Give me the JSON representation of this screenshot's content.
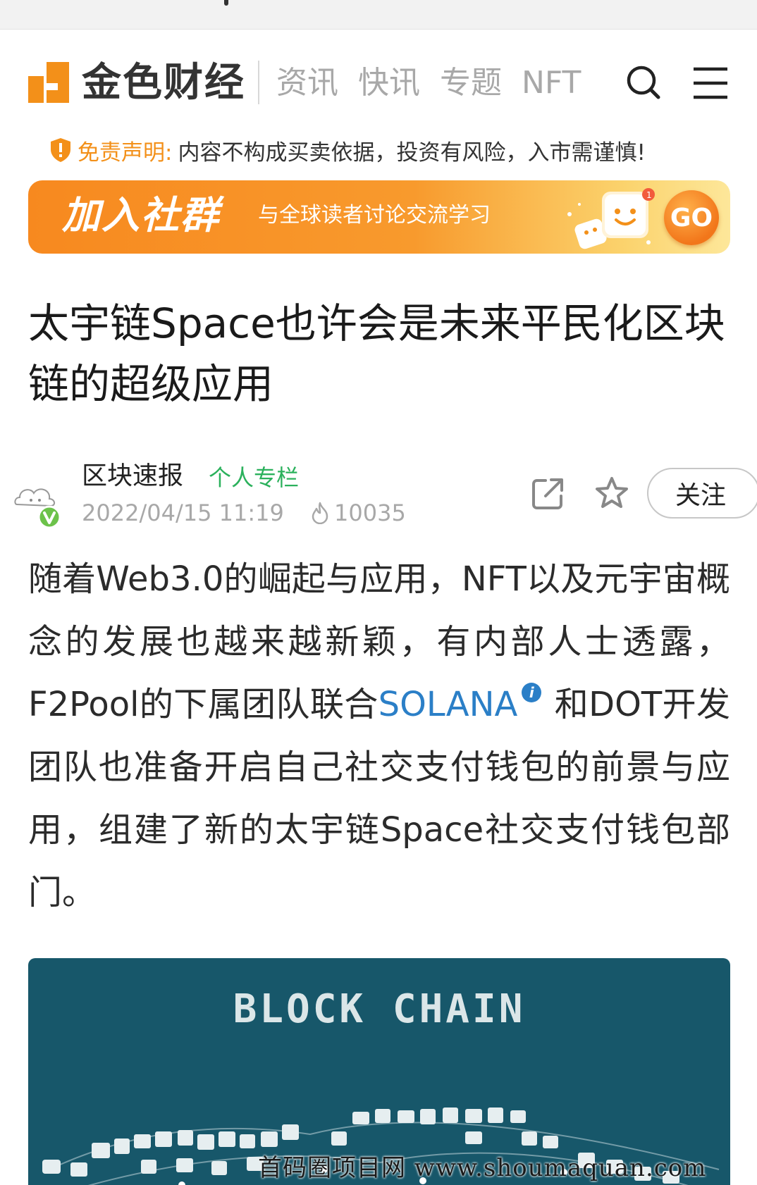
{
  "header": {
    "brand": "金色财经",
    "nav": [
      "资讯",
      "快讯",
      "专题",
      "NFT"
    ],
    "accent_color": "#f39019",
    "icons": [
      "search-icon",
      "menu-icon"
    ]
  },
  "disclaimer": {
    "label": "免责声明:",
    "text": "内容不构成买卖依据，投资有风险，入市需谨慎!"
  },
  "banner": {
    "title": "加入社群",
    "subtitle": "与全球读者讨论交流学习",
    "go_label": "GO"
  },
  "article": {
    "title": "太宇链Space也许会是未来平民化区块链的超级应用",
    "author": {
      "name": "区块速报",
      "tag": "个人专栏",
      "date": "2022/04/15 11:19",
      "views": "10035",
      "follow_label": "关注"
    },
    "body_before_link": "随着Web3.0的崛起与应用，NFT以及元宇宙概念的发展也越来越新颖，有内部人士透露，F2Pool的下属团队联合",
    "body_link": "SOLANA",
    "body_after_link": "和DOT开发团队也准备开启自己社交支付钱包的前景与应用，组建了新的太宇链Space社交支付钱包部门。",
    "image_caption": "BLOCK CHAIN"
  },
  "watermark": "首码圈项目网 www.shoumaquan.com"
}
